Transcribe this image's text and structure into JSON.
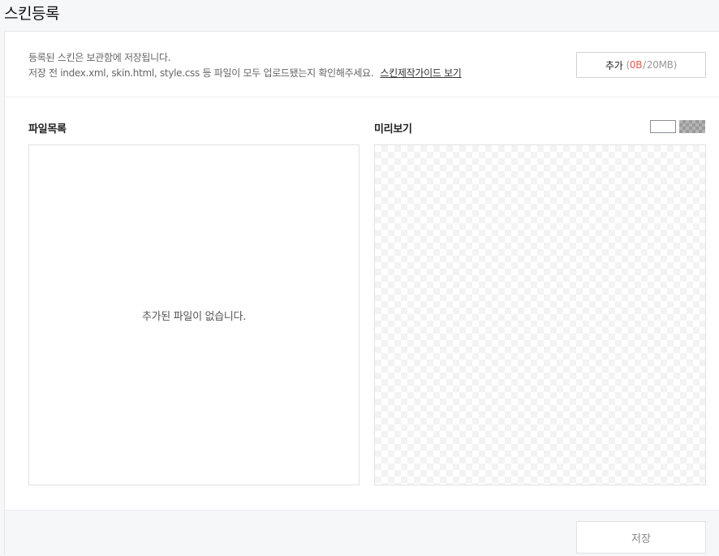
{
  "page": {
    "title": "스킨등록"
  },
  "info": {
    "line1": "등록된 스킨은 보관함에 저장됩니다.",
    "line2": "저장 전 index.xml, skin.html, style.css 등 파일이 모두 업로드됐는지 확인해주세요.",
    "guide_link": "스킨제작가이드 보기"
  },
  "add_button": {
    "label": "추가",
    "open_paren": "(",
    "used": "0B",
    "separator": "/",
    "limit": "20MB",
    "close_paren": ")"
  },
  "file_list": {
    "label": "파일목록",
    "empty_message": "추가된 파일이 없습니다."
  },
  "preview": {
    "label": "미리보기",
    "bg_options": [
      "white",
      "checker"
    ]
  },
  "footer": {
    "save_label": "저장"
  },
  "colors": {
    "used_size": "#e8594c",
    "border": "#dfe1e4",
    "background": "#f6f7f9"
  }
}
